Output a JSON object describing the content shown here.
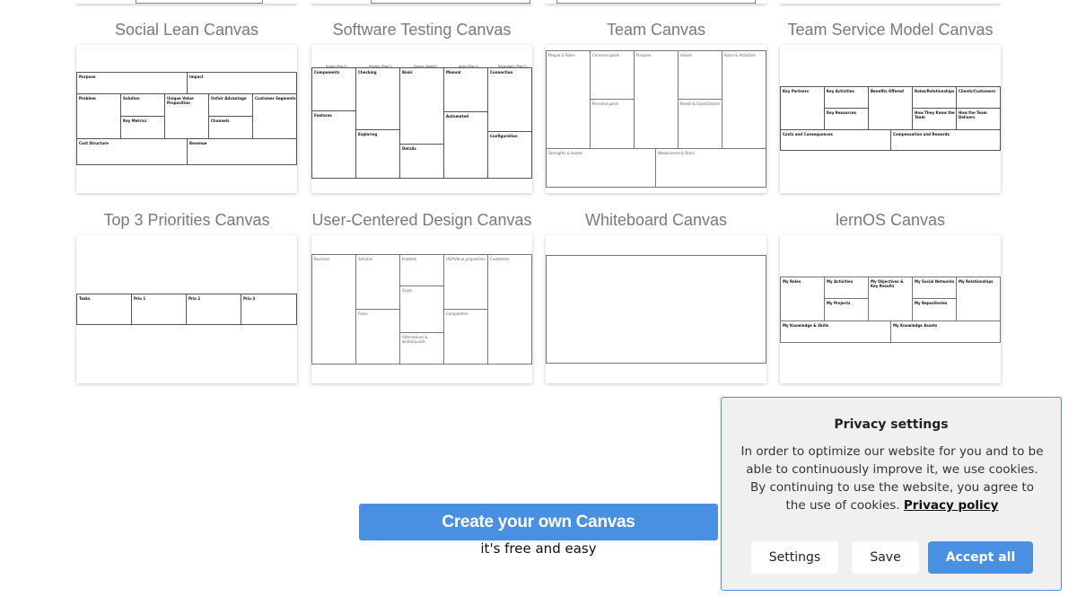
{
  "canvases": [
    {
      "title": "Social Lean Canvas",
      "cells": [
        "Purpose",
        "Impact",
        "Problem",
        "Solution",
        "Unique Value Proposition",
        "Unfair Advantage",
        "Customer Segments",
        "Key Metrics",
        "Channels",
        "Cost Structure",
        "Revenue"
      ]
    },
    {
      "title": "Software Testing Canvas",
      "headers": [
        "Scope (Plan?)",
        "Priority (Plan?)",
        "Dunno (Need?)",
        "Apps (Plan?)",
        "Secondary (Plan?)"
      ],
      "cells": [
        "Components",
        "Checking",
        "Basic",
        "Manual",
        "Connection",
        "Features",
        "Automated",
        "Exploring",
        "Details",
        "Configuration"
      ]
    },
    {
      "title": "Team Canvas",
      "cells": [
        "People & Roles",
        "Common goals",
        "Purpose",
        "Values",
        "Rules & Activities",
        "Personal goals",
        "Needs & Expectations",
        "Strengths & Assets",
        "Weaknesses & Risks"
      ]
    },
    {
      "title": "Team Service Model Canvas",
      "cells": [
        "Key Partners",
        "Key Activities",
        "Benefits Offered",
        "Roles/Relationships",
        "Clients/Customers",
        "Key Resources",
        "How They Know the Team",
        "How the Team Delivers",
        "Costs and Consequences",
        "Compensation and Rewards"
      ]
    },
    {
      "title": "Top 3 Priorities Canvas",
      "cells": [
        "Tasks",
        "Prio 1",
        "Prio 2",
        "Prio 3"
      ]
    },
    {
      "title": "User-Centered Design Canvas",
      "cells": [
        "Business",
        "Solution",
        "Problem",
        "USP/Value proposition",
        "Customers",
        "Goals",
        "Fears",
        "Competitors",
        "Alternatives & workarounds"
      ]
    },
    {
      "title": "Whiteboard Canvas",
      "cells": []
    },
    {
      "title": "lernOS Canvas",
      "cells": [
        "My Roles",
        "My Activities",
        "My Objectives & Key Results",
        "My Social Networks",
        "My Relationships",
        "My Projects",
        "My Repositories",
        "My Knowledge & Skills",
        "My Knowledge Assets"
      ]
    }
  ],
  "cta": {
    "label": "Create your own Canvas",
    "subtitle": "it's free and easy"
  },
  "privacy": {
    "title": "Privacy settings",
    "text": "In order to optimize our website for you and to be able to continuously improve it, we use cookies. By continuing to use the website, you agree to the use of cookies.",
    "link": "Privacy policy",
    "buttons": {
      "settings": "Settings",
      "save": "Save",
      "accept": "Accept all"
    }
  },
  "colors": {
    "accent": "#4a90e2",
    "title": "#7a7a7a",
    "panel": "#f0f0f0"
  }
}
